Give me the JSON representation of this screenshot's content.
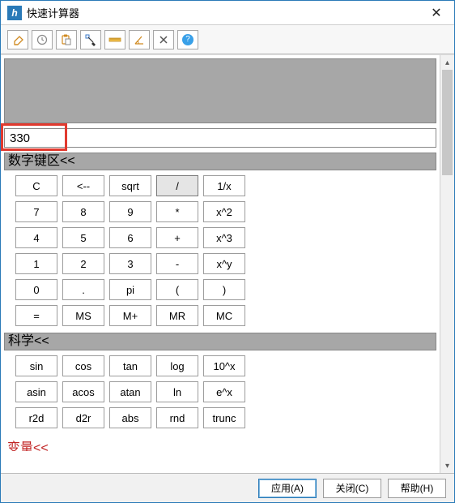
{
  "window": {
    "title": "快速计算器",
    "close_glyph": "✕"
  },
  "toolbar": {
    "icons": [
      {
        "name": "eraser-icon"
      },
      {
        "name": "clock-icon"
      },
      {
        "name": "paste-icon"
      },
      {
        "name": "pick-point-icon"
      },
      {
        "name": "ruler-icon"
      },
      {
        "name": "angle-icon"
      },
      {
        "name": "x-icon"
      },
      {
        "name": "help-icon"
      }
    ],
    "help_glyph": "?"
  },
  "input": {
    "value": "330"
  },
  "sections": {
    "numpad_title": "数字键区<<",
    "science_title": "科学<<",
    "variables_title": "变量<<"
  },
  "numpad": {
    "rows": [
      [
        "C",
        "<--",
        "sqrt",
        "/",
        "1/x"
      ],
      [
        "7",
        "8",
        "9",
        "*",
        "x^2"
      ],
      [
        "4",
        "5",
        "6",
        "+",
        "x^3"
      ],
      [
        "1",
        "2",
        "3",
        "-",
        "x^y"
      ],
      [
        "0",
        ".",
        "pi",
        "(",
        ")"
      ],
      [
        "=",
        "MS",
        "M+",
        "MR",
        "MC"
      ]
    ],
    "active": "/"
  },
  "science": {
    "rows": [
      [
        "sin",
        "cos",
        "tan",
        "log",
        "10^x"
      ],
      [
        "asin",
        "acos",
        "atan",
        "ln",
        "e^x"
      ],
      [
        "r2d",
        "d2r",
        "abs",
        "rnd",
        "trunc"
      ]
    ]
  },
  "footer": {
    "apply": "应用(A)",
    "close": "关闭(C)",
    "help": "帮助(H)"
  },
  "scrollbar": {
    "up_glyph": "▴",
    "down_glyph": "▾"
  }
}
